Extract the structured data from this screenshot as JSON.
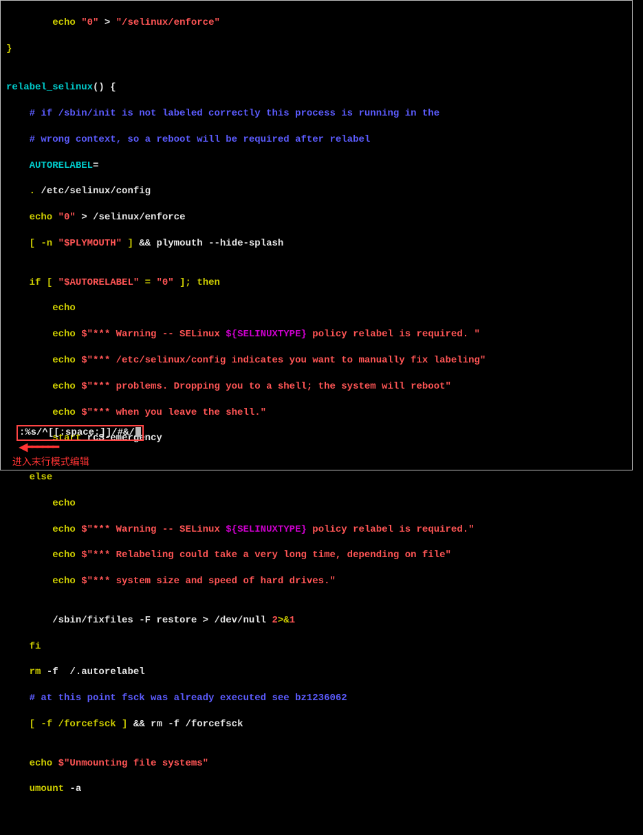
{
  "code": {
    "l1a": "        echo ",
    "l1b": "\"0\"",
    "l1c": " > ",
    "l1d": "\"/selinux/enforce\"",
    "l2": "}",
    "l3": "",
    "l4a": "relabel_selinux",
    "l4b": "() {",
    "l5": "    # if /sbin/init is not labeled correctly this process is running in the",
    "l6": "    # wrong context, so a reboot will be required after relabel",
    "l7a": "    ",
    "l7b": "AUTORELABEL",
    "l7c": "=",
    "l8a": "    .",
    "l8b": " /etc/selinux/config",
    "l9a": "    echo ",
    "l9b": "\"0\"",
    "l9c": " > /selinux/enforce",
    "l10a": "    [ -n ",
    "l10b": "\"$PLYMOUTH\"",
    "l10c": " ] ",
    "l10d": "&&",
    "l10e": " plymouth --hide-splash",
    "l11": "",
    "l12a": "    if",
    "l12b": " [ ",
    "l12c": "\"$AUTORELABEL\"",
    "l12d": " = ",
    "l12e": "\"0\"",
    "l12f": " ]; ",
    "l12g": "then",
    "l13": "        echo",
    "l14a": "        echo ",
    "l14b": "$\"*** Warning -- SELinux ",
    "l14c": "${SELINUXTYPE}",
    "l14d": " policy relabel is required. \"",
    "l15a": "        echo ",
    "l15b": "$\"*** /etc/selinux/config indicates you want to manually fix labeling\"",
    "l16a": "        echo ",
    "l16b": "$\"*** problems. Dropping you to a shell; the system will reboot\"",
    "l17a": "        echo ",
    "l17b": "$\"*** when you leave the shell.\"",
    "l18a": "        start",
    "l18b": " rcS-emergency",
    "l19": "",
    "l20": "    else",
    "l21": "        echo",
    "l22a": "        echo ",
    "l22b": "$\"*** Warning -- SELinux ",
    "l22c": "${SELINUXTYPE}",
    "l22d": " policy relabel is required.\"",
    "l23a": "        echo ",
    "l23b": "$\"*** Relabeling could take a very long time, depending on file\"",
    "l24a": "        echo ",
    "l24b": "$\"*** system size and speed of hard drives.\"",
    "l25": "",
    "l26a": "        /sbin/fixfiles -F restore > /dev/null ",
    "l26b": "2",
    "l26c": ">&",
    "l26d": "1",
    "l27": "    fi",
    "l28a": "    rm",
    "l28b": " -f  /.autorelabel",
    "l29": "    # at this point fsck was already executed see bz1236062",
    "l30a": "    [ -f /forcefsck ] ",
    "l30b": "&&",
    "l30c": " rm -f /forcefsck",
    "l31": "",
    "l32a": "    echo ",
    "l32b": "$\"Unmounting file systems\"",
    "l33a": "    umount",
    "l33b": " -a"
  },
  "command": ":%s/^[[:space:]]/#&/",
  "annotation": "进入末行模式编辑"
}
